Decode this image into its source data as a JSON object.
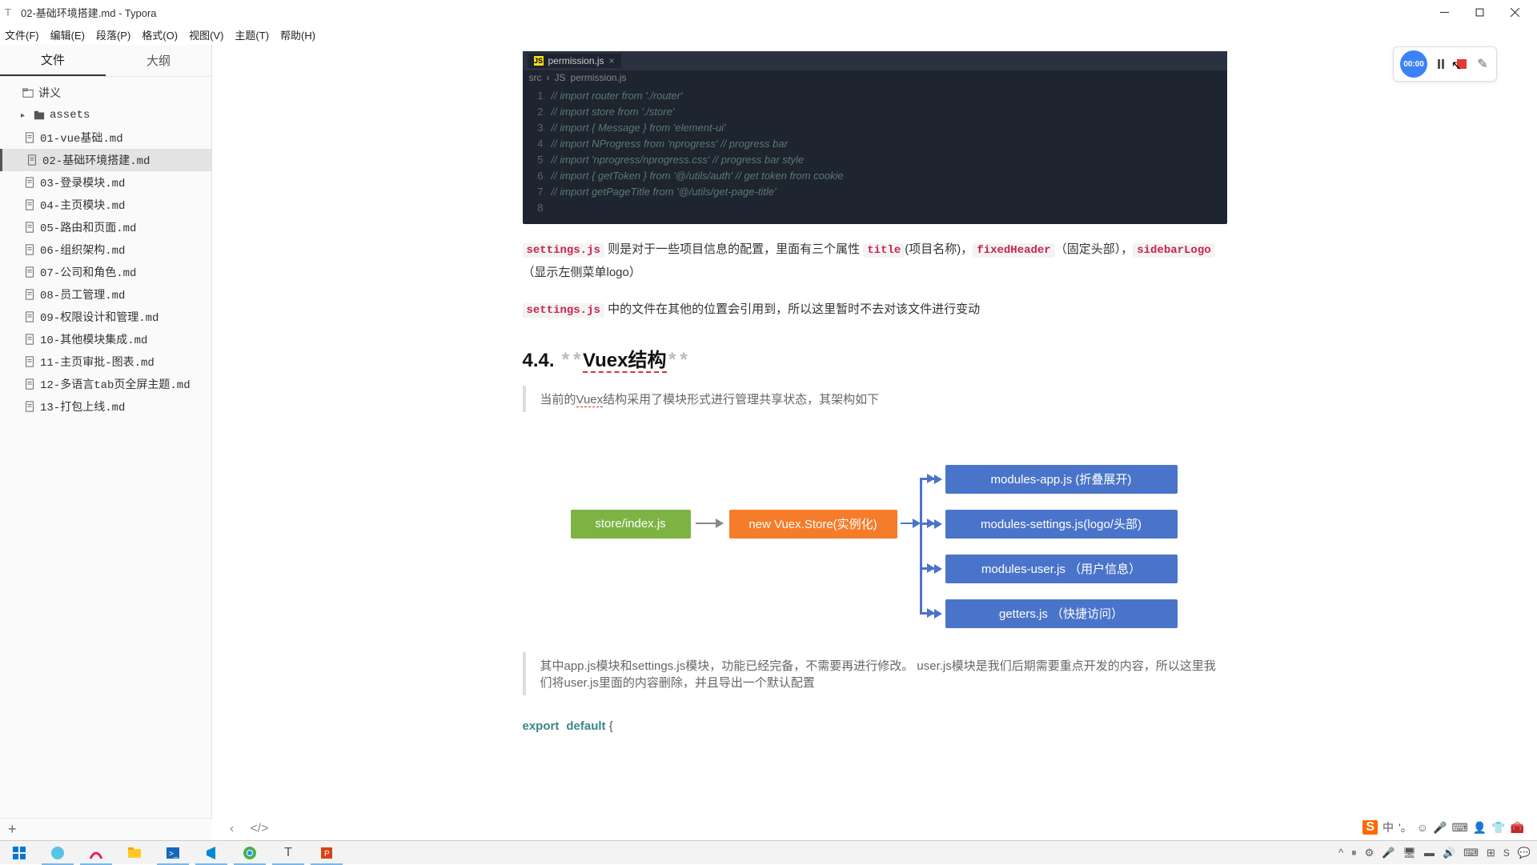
{
  "window": {
    "title": "02-基础环境搭建.md - Typora"
  },
  "menu": {
    "file": "文件(F)",
    "edit": "编辑(E)",
    "paragraph": "段落(P)",
    "format": "格式(O)",
    "view": "视图(V)",
    "theme": "主题(T)",
    "help": "帮助(H)"
  },
  "sidebar": {
    "tab_files": "文件",
    "tab_outline": "大纲",
    "root": "讲义",
    "folder_assets": "assets",
    "files": [
      "01-vue基础.md",
      "02-基础环境搭建.md",
      "03-登录模块.md",
      "04-主页模块.md",
      "05-路由和页面.md",
      "06-组织架构.md",
      "07-公司和角色.md",
      "08-员工管理.md",
      "09-权限设计和管理.md",
      "10-其他模块集成.md",
      "11-主页审批-图表.md",
      "12-多语言tab页全屏主题.md",
      "13-打包上线.md"
    ],
    "selected_index": 1
  },
  "editor_tab": {
    "name": "permission.js",
    "breadcrumb_src": "src",
    "breadcrumb_file": "permission.js"
  },
  "code_lines": [
    "// import router from './router'",
    "// import store from './store'",
    "// import { Message } from 'element-ui'",
    "// import NProgress from 'nprogress' // progress bar",
    "// import 'nprogress/nprogress.css' // progress bar style",
    "// import { getToken } from '@/utils/auth' // get token from cookie",
    "// import getPageTitle from '@/utils/get-page-title'",
    ""
  ],
  "para1": {
    "code1": "settings.js",
    "text1": " 则是对于一些项目信息的配置，里面有三个属性 ",
    "code2": "title",
    "text2": "(项目名称)，",
    "code3": "fixedHeader",
    "text3": "（固定头部），",
    "code4": "sidebarLogo",
    "text4": "（显示左侧菜单logo）"
  },
  "para2": {
    "code1": "settings.js",
    "text1": " 中的文件在其他的位置会引用到，所以这里暂时不去对该文件进行变动"
  },
  "heading": {
    "number": "4.4. ",
    "title": "Vuex结构"
  },
  "blockquote1": "当前的Vuex结构采用了模块形式进行管理共享状态，其架构如下",
  "diagram": {
    "store": "store/index.js",
    "vuex": "new Vuex.Store(实例化)",
    "m1": "modules-app.js (折叠展开)",
    "m2": "modules-settings.js(logo/头部)",
    "m3": "modules-user.js （用户信息）",
    "m4": "getters.js （快捷访问）"
  },
  "blockquote2": "其中app.js模块和settings.js模块，功能已经完备，不需要再进行修改。 user.js模块是我们后期需要重点开发的内容，所以这里我们将user.js里面的内容删除，并且导出一个默认配置",
  "export_line": {
    "kw1": "export",
    "kw2": "default",
    "brace": "  {"
  },
  "recorder": {
    "timer": "00:00"
  },
  "ime": {
    "lang": "中",
    "punct": "'。",
    "face": "☺"
  }
}
